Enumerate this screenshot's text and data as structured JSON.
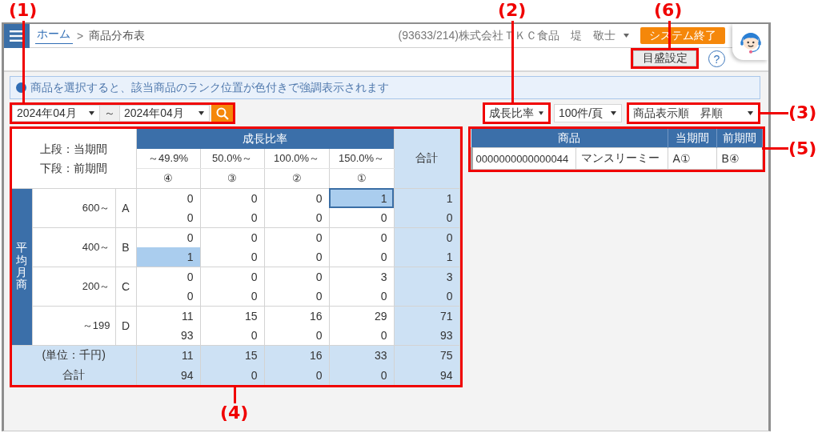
{
  "annotations": [
    {
      "label": "(1)"
    },
    {
      "label": "(2)"
    },
    {
      "label": "(6)"
    },
    {
      "label": "(3)"
    },
    {
      "label": "(5)"
    },
    {
      "label": "(4)"
    }
  ],
  "header": {
    "breadcrumb": {
      "items": [
        {
          "label": "ホーム",
          "kind": "link"
        },
        {
          "label": "商品分布表",
          "kind": "current"
        }
      ],
      "separator": ">"
    },
    "user": "(93633/214)株式会社ＴＫＣ食品　堤　敬士",
    "logout_button": "システム終了",
    "scale_button": "目盛設定",
    "help_button": "?"
  },
  "info_message": "商品を選択すると、該当商品のランク位置が色付きで強調表示されます",
  "filters": {
    "date_from": "2024年04月",
    "range_separator": "～",
    "date_to": "2024年04月",
    "metric": "成長比率",
    "page_size": "100件/頁",
    "sort_order": "商品表示順　昇順"
  },
  "distribution": {
    "legend": [
      "上段：当期間",
      "下段：前期間"
    ],
    "group_header": "成長比率",
    "columns": [
      {
        "range": "～49.9%",
        "rank": "④"
      },
      {
        "range": "50.0%～",
        "rank": "③"
      },
      {
        "range": "100.0%～",
        "rank": "②"
      },
      {
        "range": "150.0%～",
        "rank": "①"
      }
    ],
    "total_header": "合計",
    "row_axis": "平均月商",
    "rows": [
      {
        "range": "600～",
        "rank": "A",
        "current": {
          "cells": [
            {
              "value": "0",
              "highlighted": false
            },
            {
              "value": "0",
              "highlighted": false
            },
            {
              "value": "0",
              "highlighted": false
            },
            {
              "value": "1",
              "highlighted": true
            }
          ],
          "total": "1"
        },
        "previous": {
          "cells": [
            {
              "value": "0",
              "highlighted": false
            },
            {
              "value": "0",
              "highlighted": false
            },
            {
              "value": "0",
              "highlighted": false
            },
            {
              "value": "0",
              "highlighted": false
            }
          ],
          "total": "0"
        }
      },
      {
        "range": "400～",
        "rank": "B",
        "current": {
          "cells": [
            {
              "value": "0",
              "highlighted": false
            },
            {
              "value": "0",
              "highlighted": false
            },
            {
              "value": "0",
              "highlighted": false
            },
            {
              "value": "0",
              "highlighted": false
            }
          ],
          "total": "0"
        },
        "previous": {
          "cells": [
            {
              "value": "1",
              "highlighted": true
            },
            {
              "value": "0",
              "highlighted": false
            },
            {
              "value": "0",
              "highlighted": false
            },
            {
              "value": "0",
              "highlighted": false
            }
          ],
          "total": "1"
        }
      },
      {
        "range": "200～",
        "rank": "C",
        "current": {
          "cells": [
            {
              "value": "0",
              "highlighted": false
            },
            {
              "value": "0",
              "highlighted": false
            },
            {
              "value": "0",
              "highlighted": false
            },
            {
              "value": "3",
              "highlighted": false
            }
          ],
          "total": "3"
        },
        "previous": {
          "cells": [
            {
              "value": "0",
              "highlighted": false
            },
            {
              "value": "0",
              "highlighted": false
            },
            {
              "value": "0",
              "highlighted": false
            },
            {
              "value": "0",
              "highlighted": false
            }
          ],
          "total": "0"
        }
      },
      {
        "range": "～199",
        "rank": "D",
        "current": {
          "cells": [
            {
              "value": "11",
              "highlighted": false
            },
            {
              "value": "15",
              "highlighted": false
            },
            {
              "value": "16",
              "highlighted": false
            },
            {
              "value": "29",
              "highlighted": false
            }
          ],
          "total": "71"
        },
        "previous": {
          "cells": [
            {
              "value": "93",
              "highlighted": false
            },
            {
              "value": "0",
              "highlighted": false
            },
            {
              "value": "0",
              "highlighted": false
            },
            {
              "value": "0",
              "highlighted": false
            }
          ],
          "total": "93"
        }
      }
    ],
    "totals": {
      "unit": "(単位：千円)",
      "label": "合計",
      "current": {
        "values": [
          "11",
          "15",
          "16",
          "33"
        ],
        "total": "75"
      },
      "previous": {
        "values": [
          "94",
          "0",
          "0",
          "0"
        ],
        "total": "94"
      }
    }
  },
  "products": {
    "columns": [
      "商品",
      "当期間",
      "前期間"
    ],
    "rows": [
      {
        "code": "0000000000000044",
        "name": "マンスリーミー",
        "current_rank": "A①",
        "previous_rank": "B④"
      }
    ]
  }
}
